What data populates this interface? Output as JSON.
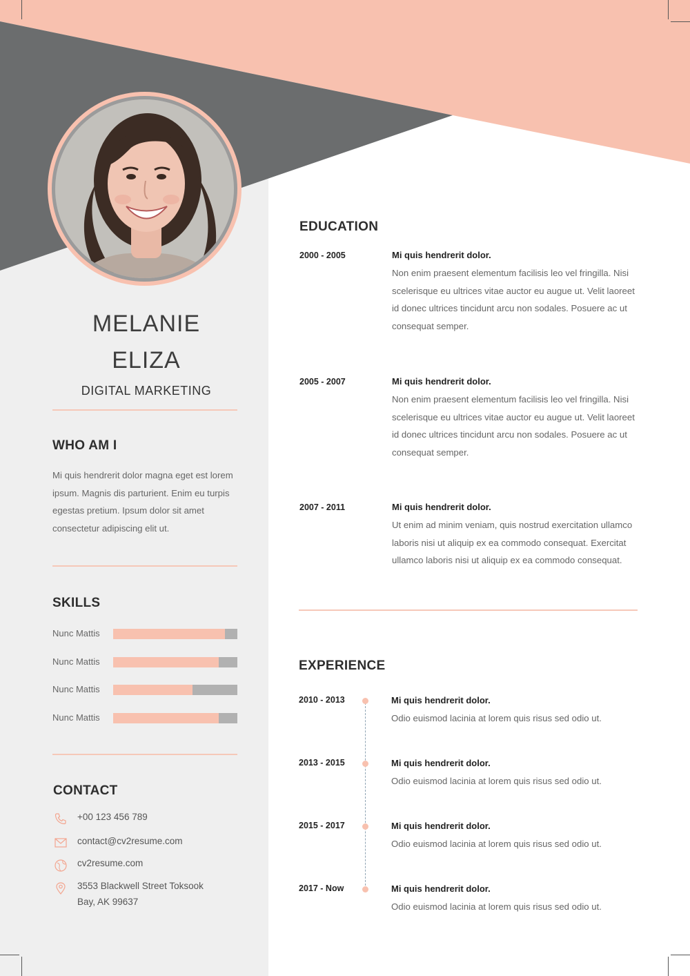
{
  "profile": {
    "first_name": "MELANIE",
    "last_name": "ELIZA",
    "role": "DIGITAL MARKETING"
  },
  "about": {
    "heading": "WHO AM I",
    "text": "Mi quis hendrerit dolor magna eget est lorem ipsum. Magnis dis parturient. Enim eu turpis egestas pretium. Ipsum dolor sit amet consectetur adipiscing elit ut."
  },
  "skills": {
    "heading": "SKILLS",
    "items": [
      {
        "label": "Nunc Mattis",
        "level": 0.9
      },
      {
        "label": "Nunc Mattis",
        "level": 0.85
      },
      {
        "label": "Nunc Mattis",
        "level": 0.64
      },
      {
        "label": "Nunc Mattis",
        "level": 0.85
      }
    ]
  },
  "contact": {
    "heading": "CONTACT",
    "phone": "+00 123 456 789",
    "email": "contact@cv2resume.com",
    "website": "cv2resume.com",
    "address_line1": "3553 Blackwell Street Toksook",
    "address_line2": "Bay, AK 99637"
  },
  "education": {
    "heading": "EDUCATION",
    "entries": [
      {
        "dates": "2000 - 2005",
        "title": "Mi quis hendrerit dolor.",
        "desc": "Non enim praesent elementum facilisis leo vel fringilla. Nisi scelerisque eu ultrices vitae auctor eu augue ut. Velit laoreet id donec ultrices tincidunt arcu non sodales. Posuere ac ut consequat semper."
      },
      {
        "dates": "2005 - 2007",
        "title": "Mi quis hendrerit dolor.",
        "desc": "Non enim praesent elementum facilisis leo vel fringilla. Nisi scelerisque eu ultrices vitae auctor eu augue ut. Velit laoreet id donec ultrices tincidunt arcu non sodales. Posuere ac ut consequat semper."
      },
      {
        "dates": "2007 - 2011",
        "title": "Mi quis hendrerit dolor.",
        "desc": "Ut enim ad minim veniam, quis nostrud exercitation ullamco laboris nisi ut aliquip ex ea commodo consequat. Exercitat ullamco laboris nisi ut aliquip ex ea commodo consequat."
      }
    ]
  },
  "experience": {
    "heading": "EXPERIENCE",
    "entries": [
      {
        "dates": "2010 - 2013",
        "title": "Mi quis hendrerit dolor.",
        "desc": "Odio euismod lacinia at lorem quis risus sed odio ut."
      },
      {
        "dates": "2013 - 2015",
        "title": "Mi quis hendrerit dolor.",
        "desc": "Odio euismod lacinia at lorem quis risus sed odio ut."
      },
      {
        "dates": "2015 - 2017",
        "title": "Mi quis hendrerit dolor.",
        "desc": "Odio euismod lacinia at lorem quis risus sed odio ut."
      },
      {
        "dates": "2017 - Now",
        "title": "Mi quis hendrerit dolor.",
        "desc": "Odio euismod lacinia at lorem quis risus sed odio ut."
      }
    ]
  },
  "colors": {
    "accent": "#f8c1af",
    "dark_band": "#6b6d6e",
    "sidebar": "#efefef",
    "skill_track": "#b1b1b1"
  },
  "icons": [
    "phone-icon",
    "email-icon",
    "globe-icon",
    "location-pin-icon"
  ]
}
